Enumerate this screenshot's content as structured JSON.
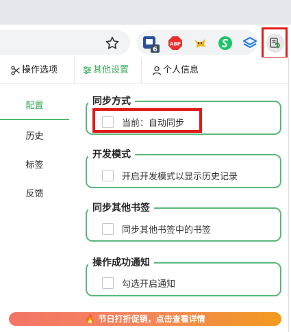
{
  "popup": {
    "tabs": [
      {
        "label": "操作选项",
        "icon": "scissors-icon"
      },
      {
        "label": "其他设置",
        "icon": "sliders-icon",
        "active": true
      },
      {
        "label": "个人信息",
        "icon": "user-icon"
      }
    ],
    "sidebar": [
      {
        "label": "配置",
        "active": true
      },
      {
        "label": "历史"
      },
      {
        "label": "标签"
      },
      {
        "label": "反馈"
      }
    ],
    "groups": [
      {
        "title": "同步方式",
        "option": "当前：自动同步"
      },
      {
        "title": "开发模式",
        "option": "开启开发模式以显示历史记录"
      },
      {
        "title": "同步其他书签",
        "option": "同步其他书签中的书签"
      },
      {
        "title": "操作成功通知",
        "option": "勾选开启通知"
      }
    ],
    "promo": {
      "icon": "fire-icon",
      "text": "节日打折促销，点击查看详情"
    }
  },
  "toolbar": {
    "extensions": [
      {
        "name": "counter-extension-icon",
        "badge": "6"
      },
      {
        "name": "adblock-plus-icon",
        "text": "ABP"
      },
      {
        "name": "fox-extension-icon"
      },
      {
        "name": "green-s-extension-icon"
      },
      {
        "name": "layers-extension-icon"
      },
      {
        "name": "bookmark-sync-extension-icon"
      }
    ]
  },
  "colors": {
    "accent": "#3fae5e",
    "group_border": "#5cb87a",
    "highlight": "#e11b1b",
    "promo_start": "#f47565",
    "promo_end": "#f29a1f"
  }
}
